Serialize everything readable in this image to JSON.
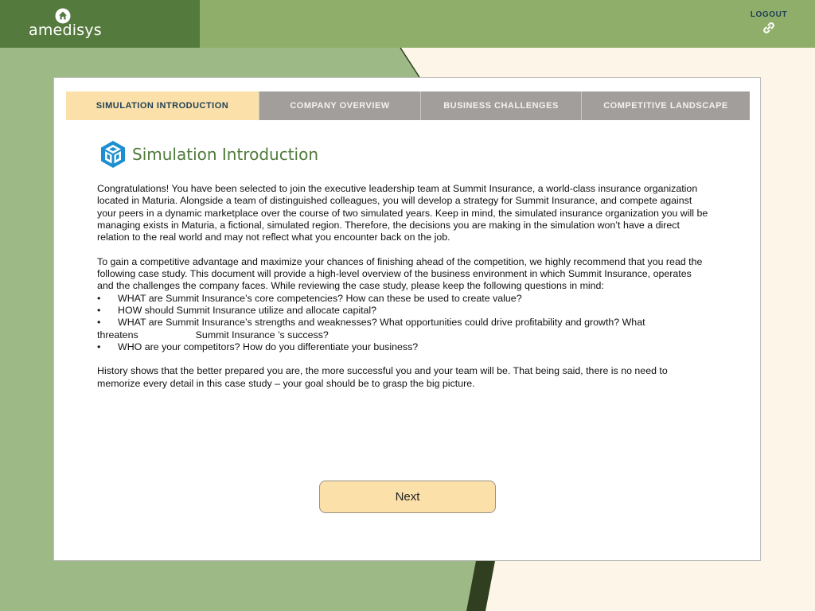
{
  "header": {
    "brand": "amedisys",
    "logout_label": "LOGOUT"
  },
  "tabs": [
    {
      "label": "SIMULATION INTRODUCTION",
      "active": true
    },
    {
      "label": "COMPANY OVERVIEW",
      "active": false
    },
    {
      "label": "BUSINESS CHALLENGES",
      "active": false
    },
    {
      "label": "COMPETITIVE LANDSCAPE",
      "active": false
    }
  ],
  "page_title": "Simulation Introduction",
  "content": {
    "p1": "Congratulations! You have been selected to join the executive leadership team at Summit Insurance, a world-class insurance organization located in Maturia. Alongside a team of distinguished colleagues, you will develop a strategy for Summit Insurance, and compete against your peers in a dynamic marketplace over the course of two simulated years. Keep in mind, the simulated insurance organization you will be managing exists in Maturia, a fictional, simulated region. Therefore, the decisions you are making in the simulation won’t have a direct relation to the real world and may not reflect what you encounter back on the job.",
    "p2": "To gain a competitive advantage and maximize your chances of finishing ahead of the competition, we highly recommend that you read the following case study. This document will provide a high-level overview of the business environment in which Summit Insurance, operates and the challenges the company faces. While reviewing the case study, please keep the following questions in mind:",
    "bullet_symbol": "•",
    "b1": "WHAT are Summit Insurance’s core competencies? How can these be used to create value?",
    "b2": "HOW should Summit Insurance utilize and allocate capital?",
    "b3": "WHAT are Summit Insurance’s strengths and weaknesses? What opportunities could drive profitability and growth? What",
    "b3_threatens": "threatens",
    "b3_rest": "Summit Insurance ’s success?",
    "b4": "WHO are your competitors? How do you differentiate your business?",
    "p3": "History shows that the better prepared you are, the more successful you and your team will be. That being said, there is no need to memorize every detail in this case study – your goal should be to grasp the big picture."
  },
  "next_label": "Next",
  "colors": {
    "header_green": "#8fae6a",
    "logo_green": "#557a3e",
    "active_tab": "#fbe0a9",
    "inactive_tab": "#a29e9c",
    "title_green": "#4f7a3b",
    "icon_blue": "#1d8fd1",
    "page_cream": "#fdf6e8",
    "dark_green_stripe": "#2f3f1f"
  },
  "icons": {
    "logo": "house-circle-icon",
    "logout": "link-icon",
    "title": "cube-icon"
  }
}
